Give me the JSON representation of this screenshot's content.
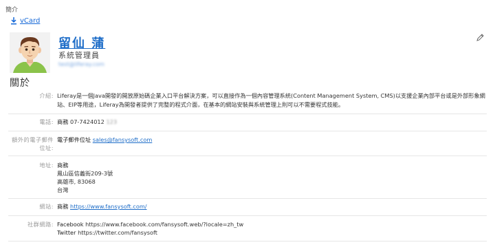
{
  "portlet": {
    "title": "簡介"
  },
  "vcard": {
    "label": "vCard",
    "icon": "download-icon"
  },
  "edit": {
    "icon": "pencil-icon"
  },
  "user": {
    "name": "留仙 蒲",
    "job_title": "系統管理員",
    "email_blurred": "test@liferay.com",
    "avatar": "avatar-icon"
  },
  "about": {
    "title": "關於",
    "intro_label": "介紹:",
    "intro_text": "Liferay是一個Java開發的開放原始碼企業入口平台解決方案，可以直接作為一個內容管理系統(Content Management System, CMS)以支援企業內部平台或是外部形象網站、EIP等用途，Liferay為開發者提供了完整的程式介面，在基本的網站安裝與系統管理上則可以不需要程式技能。",
    "phone_label": "電話:",
    "phone_type": "商務",
    "phone_number": "07-7424012",
    "phone_ext_blurred": "123",
    "extra_email_label": "額外的電子郵件位址:",
    "extra_email_type": "電子郵件位址",
    "extra_email_value": "sales@fansysoft.com",
    "address_label": "地址:",
    "address_type": "商務",
    "address_lines": [
      "鳳山區信義街209-3號",
      "高雄市, 83068",
      "台灣"
    ],
    "website_label": "網站:",
    "website_type": "商務",
    "website_url": "https://www.fansysoft.com/",
    "social_label": "社群網路:",
    "facebook_label": "Facebook",
    "facebook_url": "https://www.facebook.com/fansysoft.web/?locale=zh_tw",
    "twitter_label": "Twitter",
    "twitter_url": "https://twitter.com/fansysoft"
  }
}
